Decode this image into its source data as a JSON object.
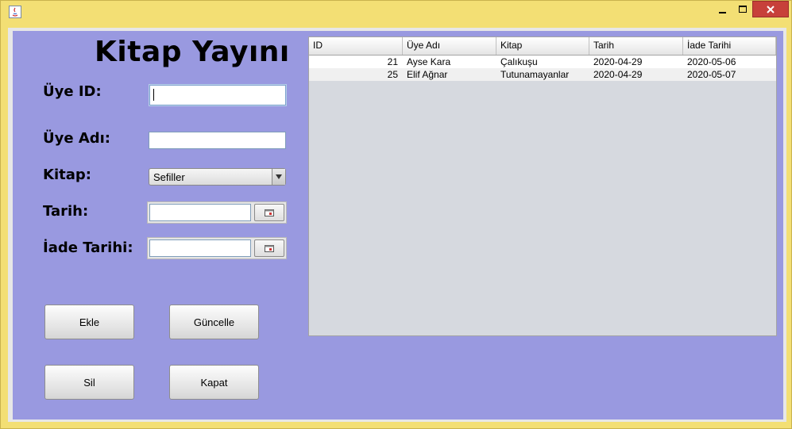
{
  "window": {
    "controls": {
      "minimize": "minimize-icon",
      "maximize": "maximize-icon",
      "close": "close-icon"
    }
  },
  "form": {
    "title": "Kitap Yayını",
    "labels": {
      "uye_id": "Üye ID:",
      "uye_adi": "Üye Adı:",
      "kitap": "Kitap:",
      "tarih": "Tarih:",
      "iade_tarihi": "İade Tarihi:"
    },
    "fields": {
      "uye_id": "",
      "uye_adi": "",
      "tarih": "",
      "iade_tarihi": ""
    },
    "kitap_selected": "Sefiller",
    "buttons": {
      "ekle": "Ekle",
      "guncelle": "Güncelle",
      "sil": "Sil",
      "kapat": "Kapat"
    }
  },
  "table": {
    "columns": [
      "ID",
      "Üye Adı",
      "Kitap",
      "Tarih",
      "İade Tarihi"
    ],
    "rows": [
      [
        "21",
        "Ayse Kara",
        "Çalıkuşu",
        "2020-04-29",
        "2020-05-06"
      ],
      [
        "25",
        "Elif Ağnar",
        "Tutunamayanlar",
        "2020-04-29",
        "2020-05-07"
      ]
    ]
  },
  "colors": {
    "panel": "#9999e0",
    "title_bar": "#f3df74",
    "close": "#c7403a"
  }
}
